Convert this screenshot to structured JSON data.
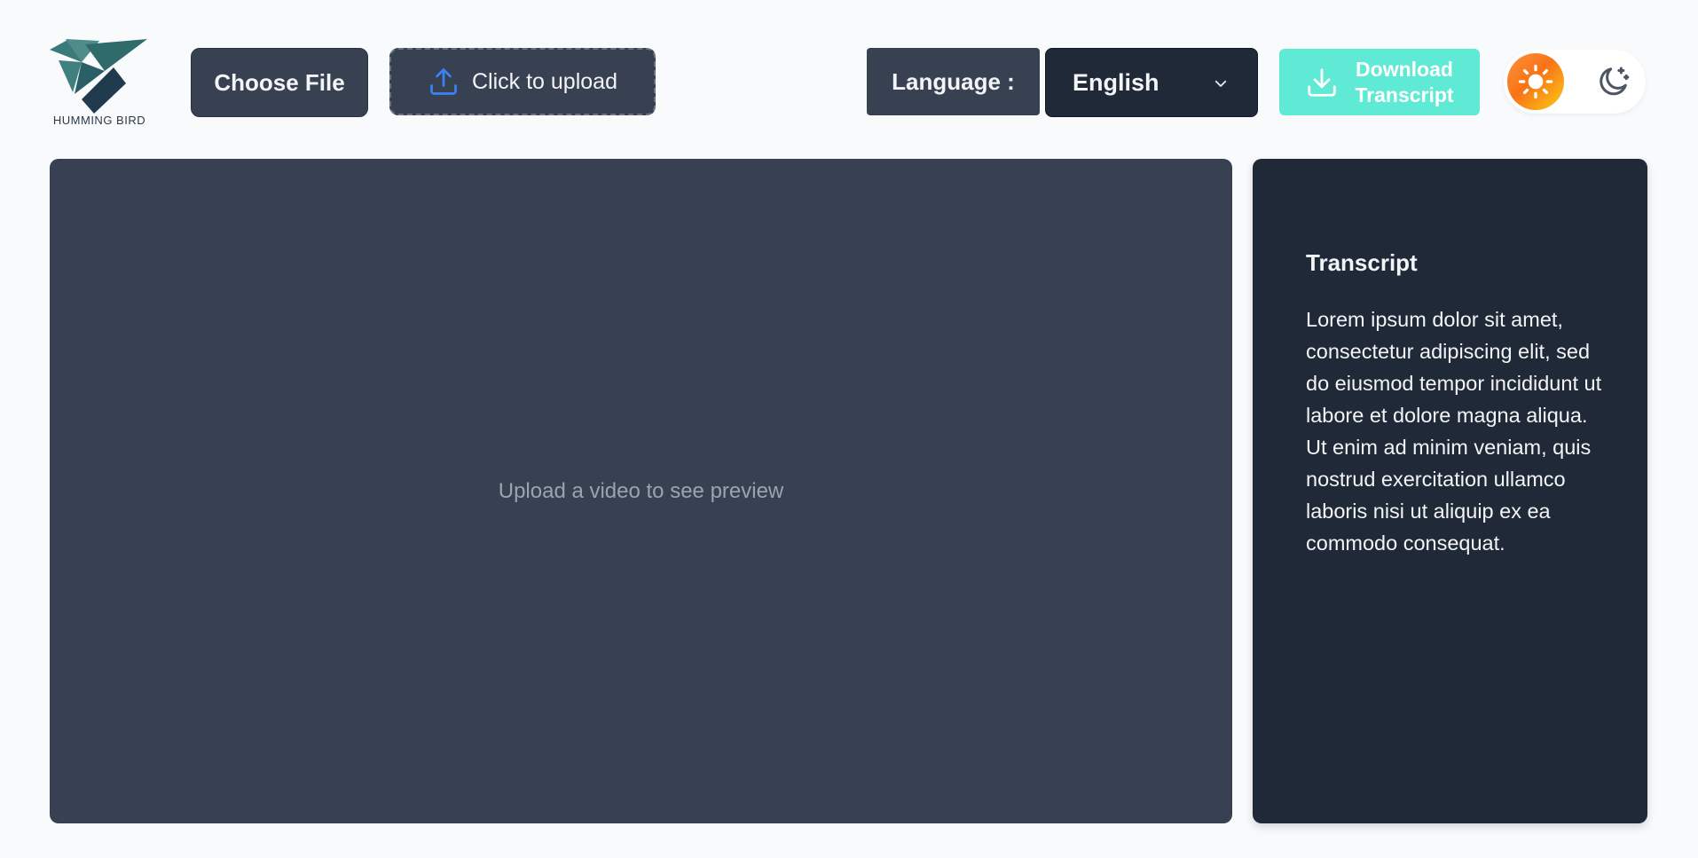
{
  "brand": {
    "name": "HUMMING BIRD",
    "colors": {
      "primary": "#3b7a7a",
      "dark": "#1f3b4d"
    }
  },
  "toolbar": {
    "choose_file_label": "Choose File",
    "upload_label": "Click to upload",
    "upload_icon": "upload-icon",
    "language_label": "Language :",
    "language_selected": "English",
    "download_label_line1": "Download",
    "download_label_line2": "Transcript",
    "download_icon": "download-icon",
    "theme": {
      "light_icon": "sun-icon",
      "dark_icon": "moon-icon",
      "active": "light"
    }
  },
  "preview": {
    "placeholder": "Upload a video to see preview"
  },
  "transcript": {
    "title": "Transcript",
    "body": "Lorem ipsum dolor sit amet, consectetur adipiscing elit, sed do eiusmod tempor incididunt ut labore et dolore magna aliqua. Ut enim ad minim veniam, quis nostrud exercitation ullamco laboris nisi ut aliquip ex ea commodo consequat."
  },
  "colors": {
    "page_bg": "#f8fafc",
    "panel": "#374151",
    "panel_dark": "#1f2937",
    "accent": "#5eead4",
    "upload_icon": "#3b82f6"
  }
}
